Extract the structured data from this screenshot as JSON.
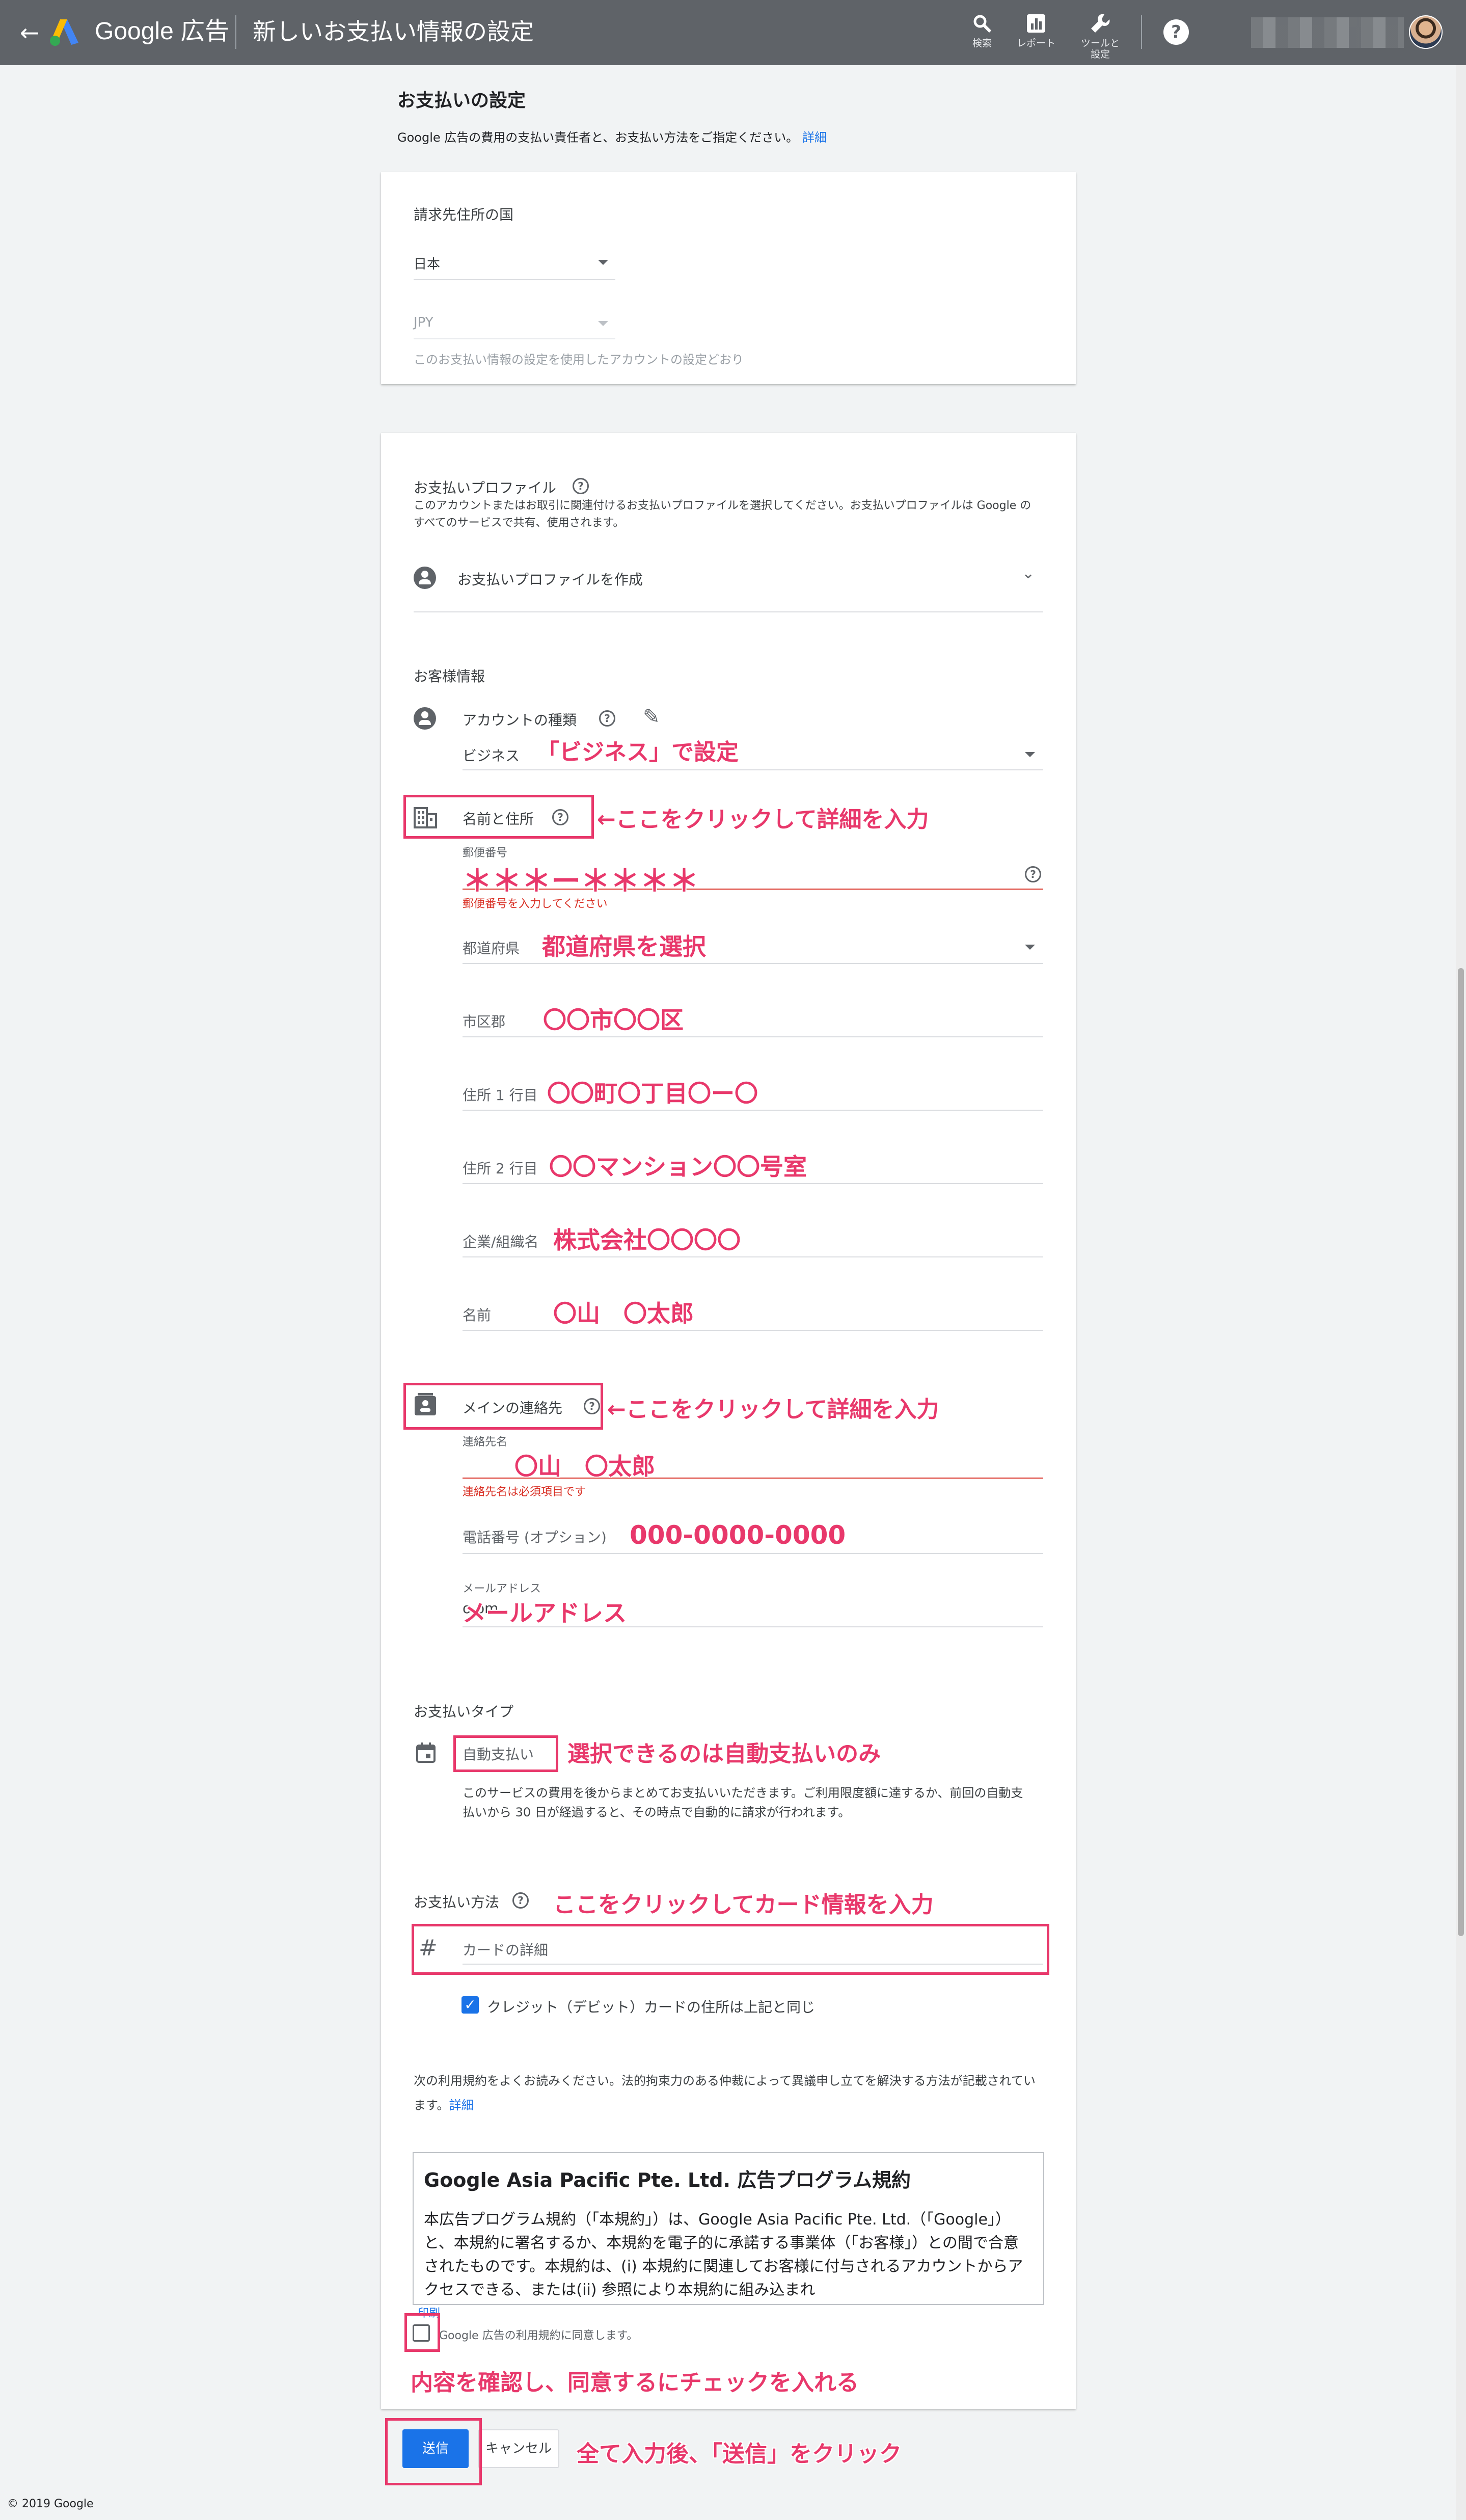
{
  "header": {
    "brand": "Google 広告",
    "page_title": "新しいお支払い情報の設定",
    "tools": [
      {
        "icon": "search-icon",
        "label": "検索"
      },
      {
        "icon": "report-icon",
        "label": "レポート"
      },
      {
        "icon": "wrench-icon",
        "label_line1": "ツールと",
        "label_line2": "設定"
      }
    ],
    "help_glyph": "?"
  },
  "main": {
    "title": "お支払いの設定",
    "description": "Google 広告の費用の支払い責任者と、お支払い方法をご指定ください。",
    "description_link": "詳細"
  },
  "billing_country": {
    "heading": "請求先住所の国",
    "country_value": "日本",
    "currency_value": "JPY",
    "currency_note": "このお支払い情報の設定を使用したアカウントの設定どおり"
  },
  "payments_profile": {
    "heading": "お支払いプロファイル",
    "description": "このアカウントまたはお取引に関連付けるお支払いプロファイルを選択してください。お支払いプロファイルは Google のすべてのサービスで共有、使用されます。",
    "selected": "お支払いプロファイルを作成"
  },
  "customer_info": {
    "heading": "お客様情報",
    "account_type_label": "アカウントの種類",
    "account_type_value": "ビジネス",
    "name_address_label": "名前と住所",
    "postal_code_label": "郵便番号",
    "postal_code_error": "郵便番号を入力してください",
    "prefecture_label": "都道府県",
    "city_label": "市区郡",
    "address1_label": "住所 1 行目",
    "address2_label": "住所 2 行目",
    "company_label": "企業/組織名",
    "name_label": "名前",
    "main_contact_label": "メインの連絡先",
    "contact_name_label": "連絡先名",
    "contact_name_error": "連絡先名は必須項目です",
    "phone_label": "電話番号 (オプション)",
    "email_label": "メールアドレス",
    "email_value": "o                      om"
  },
  "payment_type": {
    "heading": "お支払いタイプ",
    "value": "自動支払い",
    "description": "このサービスの費用を後からまとめてお支払いいただきます。ご利用限度額に達するか、前回の自動支払いから 30 日が経過すると、その時点で自動的に請求が行われます。"
  },
  "payment_method": {
    "heading": "お支払い方法",
    "card_icon_glyph": "#",
    "card_placeholder": "カードの詳細",
    "same_address_label": "クレジット（デビット）カードの住所は上記と同じ",
    "check_glyph": "✓"
  },
  "terms": {
    "intro": "次の利用規約をよくお読みください。法的拘束力のある仲裁によって異議申し立てを解決する方法が記載されています。",
    "intro_link": "詳細",
    "title": "Google Asia Pacific Pte. Ltd. 広告プログラム規約",
    "body": "本広告プログラム規約（「本規約」）は、Google Asia Pacific Pte. Ltd.（「Google」）と、本規約に署名するか、本規約を電子的に承諾する事業体（「お客様」）との間で合意されたものです。本規約は、(i) 本規約に関連してお客様に付与されるアカウントからアクセスできる、または(ii) 参照により本規約に組み込まれ",
    "print_link": "印刷",
    "agree_label": "Google 広告の利用規約に同意します。"
  },
  "actions": {
    "submit": "送信",
    "cancel": "キャンセル"
  },
  "footer": "© 2019 Google",
  "annotations": {
    "business": "「ビジネス」で設定",
    "click_name": "←ここをクリックして詳細を入力",
    "postal_mask": "＊＊＊ー＊＊＊＊",
    "prefecture": "都道府県を選択",
    "city": "〇〇市〇〇区",
    "address1": "〇〇町〇丁目〇ー〇",
    "address2": "〇〇マンション〇〇号室",
    "company": "株式会社〇〇〇〇",
    "name": "〇山　〇太郎",
    "click_contact": "←ここをクリックして詳細を入力",
    "contact_name": "〇山　〇太郎",
    "phone": "000-0000-0000",
    "email": "メールアドレス",
    "payment_type": "選択できるのは自動支払いのみ",
    "card": "ここをクリックしてカード情報を入力",
    "agree": "内容を確認し、同意するにチェックを入れる",
    "submit": "全て入力後、「送信」をクリック"
  },
  "colors": {
    "header_bg": "#5f6368",
    "accent": "#1a73e8",
    "error": "#d93025",
    "annotation": "#e8386b"
  }
}
